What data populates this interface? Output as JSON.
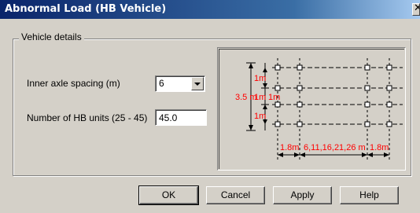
{
  "window": {
    "title": "Abnormal Load (HB Vehicle)",
    "close_glyph": "✕"
  },
  "group": {
    "label": "Vehicle details"
  },
  "fields": {
    "axle_spacing_label": "Inner axle spacing (m)",
    "axle_spacing_value": "6",
    "hb_units_label": "Number of HB units (25 - 45)",
    "hb_units_value": "45.0"
  },
  "diagram": {
    "height_label": "3.5 m",
    "top_gap_label": "1m",
    "mid_gap_label": "1m",
    "left_gap_label": "1m",
    "bottom_gap_label": "1m",
    "left_spacing_label": "1.8m",
    "middle_spacing_label": "6,11,16,21,26 m",
    "right_spacing_label": "1.8m",
    "label_color": "#ff0000"
  },
  "buttons": {
    "ok": "OK",
    "cancel": "Cancel",
    "apply": "Apply",
    "help": "Help"
  }
}
